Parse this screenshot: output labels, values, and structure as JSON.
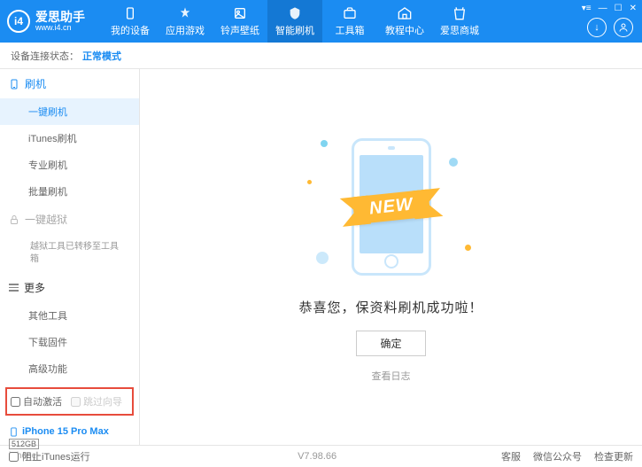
{
  "app": {
    "title": "爱思助手",
    "url": "www.i4.cn"
  },
  "nav": [
    {
      "label": "我的设备"
    },
    {
      "label": "应用游戏"
    },
    {
      "label": "铃声壁纸"
    },
    {
      "label": "智能刷机",
      "active": true
    },
    {
      "label": "工具箱"
    },
    {
      "label": "教程中心"
    },
    {
      "label": "爱思商城"
    }
  ],
  "status": {
    "label": "设备连接状态：",
    "value": "正常模式"
  },
  "sidebar": {
    "flash": {
      "title": "刷机",
      "items": [
        {
          "label": "一键刷机",
          "active": true
        },
        {
          "label": "iTunes刷机"
        },
        {
          "label": "专业刷机"
        },
        {
          "label": "批量刷机"
        }
      ]
    },
    "jailbreak": {
      "title": "一键越狱",
      "note": "越狱工具已转移至工具箱"
    },
    "more": {
      "title": "更多",
      "items": [
        {
          "label": "其他工具"
        },
        {
          "label": "下载固件"
        },
        {
          "label": "高级功能"
        }
      ]
    }
  },
  "checkboxes": {
    "auto_activate": "自动激活",
    "skip_setup": "跳过向导"
  },
  "device": {
    "name": "iPhone 15 Pro Max",
    "storage": "512GB",
    "type": "iPhone"
  },
  "main": {
    "ribbon": "NEW",
    "message": "恭喜您，保资料刷机成功啦！",
    "ok": "确定",
    "log": "查看日志"
  },
  "footer": {
    "block_itunes": "阻止iTunes运行",
    "version": "V7.98.66",
    "links": [
      "客服",
      "微信公众号",
      "检查更新"
    ]
  }
}
